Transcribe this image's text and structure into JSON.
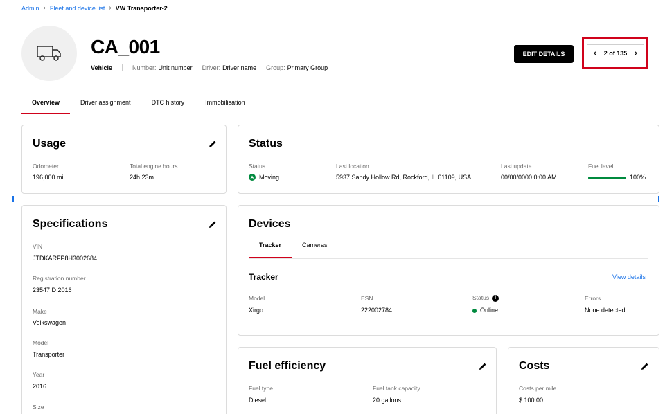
{
  "breadcrumb": {
    "items": [
      "Admin",
      "Fleet and device list"
    ],
    "current": "VW Transporter-2"
  },
  "header": {
    "avatar_icon": "truck-icon",
    "title": "CA_001",
    "type": "Vehicle",
    "number_label": "Number:",
    "number_value": "Unit number",
    "driver_label": "Driver:",
    "driver_value": "Driver name",
    "group_label": "Group:",
    "group_value": "Primary Group",
    "edit_label": "EDIT DETAILS",
    "pager_text": "2 of 135"
  },
  "tabs": [
    "Overview",
    "Driver assignment",
    "DTC history",
    "Immobilisation"
  ],
  "usage": {
    "title": "Usage",
    "odometer_label": "Odometer",
    "odometer_value": "196,000 mi",
    "hours_label": "Total engine hours",
    "hours_value": "24h 23m"
  },
  "status": {
    "title": "Status",
    "status_label": "Status",
    "status_value": "Moving",
    "location_label": "Last location",
    "location_value": "5937 Sandy Hollow Rd, Rockford, IL 61109, USA",
    "update_label": "Last update",
    "update_value": "00/00/0000 0:00 AM",
    "fuel_label": "Fuel level",
    "fuel_value": "100%",
    "fuel_fraction": 1.0
  },
  "specifications": {
    "title": "Specifications",
    "fields": [
      {
        "label": "VIN",
        "value": "JTDKARFP8H3002684"
      },
      {
        "label": "Registration number",
        "value": "23547 D 2016"
      },
      {
        "label": "Make",
        "value": "Volkswagen"
      },
      {
        "label": "Model",
        "value": "Transporter"
      },
      {
        "label": "Year",
        "value": "2016"
      },
      {
        "label": "Size",
        "value": ""
      }
    ]
  },
  "devices": {
    "title": "Devices",
    "tabs": [
      "Tracker",
      "Cameras"
    ],
    "tracker_title": "Tracker",
    "view_details": "View details",
    "model_label": "Model",
    "model_value": "Xirgo",
    "esn_label": "ESN",
    "esn_value": "222002784",
    "status_label": "Status",
    "status_value": "Online",
    "errors_label": "Errors",
    "errors_value": "None detected"
  },
  "fuel_efficiency": {
    "title": "Fuel efficiency",
    "type_label": "Fuel type",
    "type_value": "Diesel",
    "capacity_label": "Fuel tank capacity",
    "capacity_value": "20 gallons"
  },
  "costs": {
    "title": "Costs",
    "per_mile_label": "Costs per mile",
    "per_mile_value": "$ 100.00"
  },
  "colors": {
    "accent_red": "#d0021b",
    "link_blue": "#1a73e8",
    "status_green": "#008a3e"
  }
}
